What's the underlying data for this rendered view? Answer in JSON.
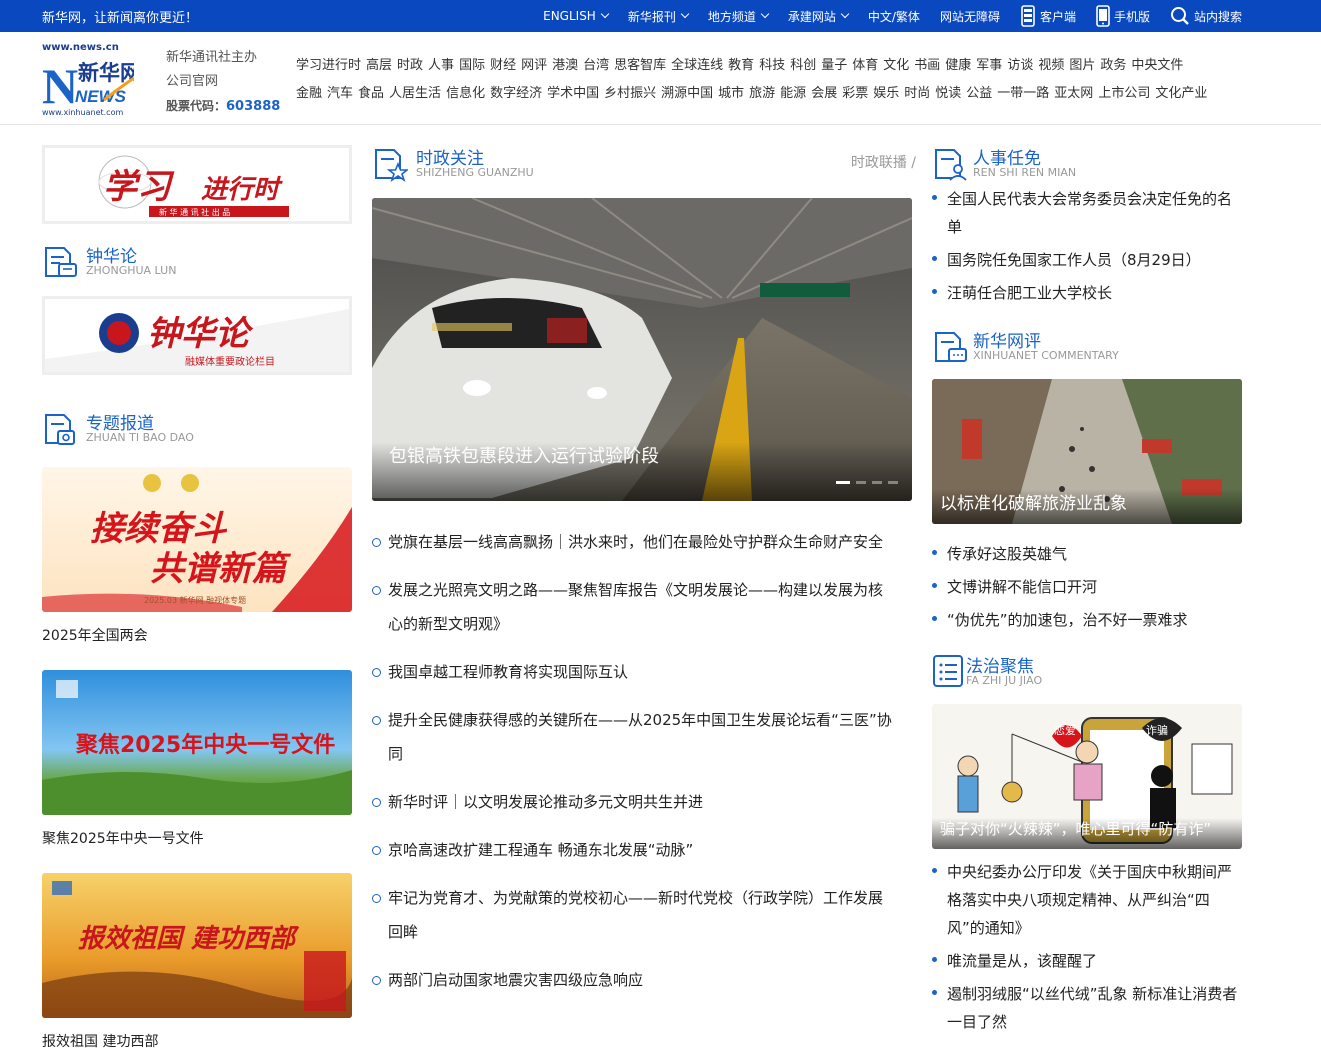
{
  "topbar": {
    "slogan": "新华网，让新闻离你更近！",
    "items": [
      {
        "label": "ENGLISH",
        "dropdown": true
      },
      {
        "label": "新华报刊",
        "dropdown": true
      },
      {
        "label": "地方频道",
        "dropdown": true
      },
      {
        "label": "承建网站",
        "dropdown": true
      },
      {
        "label": "中文/繁体",
        "dropdown": false
      },
      {
        "label": "网站无障碍",
        "dropdown": false
      },
      {
        "label": "客户端",
        "icon": "phone-icon"
      },
      {
        "label": "手机版",
        "icon": "mobile-icon"
      },
      {
        "label": "站内搜索",
        "icon": "search-icon"
      }
    ]
  },
  "header": {
    "logo_url_top": "www.news.cn",
    "logo_text": "新华网",
    "logo_news": "NEWS",
    "logo_url_bottom": "www.xinhuanet.com",
    "org_line1": "新华通讯社主办",
    "org_line2": "公司官网",
    "stock_label": "股票代码：",
    "stock_code": "603888",
    "channels_row1": [
      "学习进行时",
      "高层",
      "时政",
      "人事",
      "国际",
      "财经",
      "网评",
      "港澳",
      "台湾",
      "思客智库",
      "全球连线",
      "教育",
      "科技",
      "科创",
      "量子",
      "体育",
      "文化",
      "书画",
      "健康",
      "军事",
      "访谈",
      "视频",
      "图片",
      "政务",
      "中央文件"
    ],
    "channels_row2": [
      "金融",
      "汽车",
      "食品",
      "人居生活",
      "信息化",
      "数字经济",
      "学术中国",
      "乡村振兴",
      "溯源中国",
      "城市",
      "旅游",
      "能源",
      "会展",
      "彩票",
      "娱乐",
      "时尚",
      "悦读",
      "公益",
      "一带一路",
      "亚太网",
      "上市公司",
      "文化产业"
    ]
  },
  "left": {
    "xuexi_banner": {
      "text1": "学习",
      "text2": "进行时",
      "sub": "新 华 通 讯 社 出 品"
    },
    "zhonghua": {
      "title": "钟华论",
      "sub": "ZHONGHUA LUN",
      "banner_text": "钟华论",
      "banner_sub": "融媒体重要政论栏目"
    },
    "zhuanti": {
      "title": "专题报道",
      "sub": "ZHUAN TI BAO DAO"
    },
    "specials": [
      {
        "caption": "2025年全国两会",
        "img_line1": "接续奋斗",
        "img_line2": "共谱新篇",
        "img_tag": "2025.03  新华网  融视体专题"
      },
      {
        "caption": "聚焦2025年中央一号文件",
        "img_line1": "聚焦2025年中央一号文件"
      },
      {
        "caption": "报效祖国 建功西部",
        "img_line1": "报效祖国 建功西部"
      }
    ]
  },
  "center": {
    "title": "时政关注",
    "sub": "SHIZHENG GUANZHU",
    "more_label": "时政联播",
    "slide_caption": "包银高铁包惠段进入运行试验阶段",
    "slide_dots": 4,
    "news": [
      "党旗在基层一线高高飘扬｜洪水来时，他们在最险处守护群众生命财产安全",
      "发展之光照亮文明之路——聚焦智库报告《文明发展论——构建以发展为核心的新型文明观》",
      "我国卓越工程师教育将实现国际互认",
      "提升全民健康获得感的关键所在——从2025年中国卫生发展论坛看“三医”协同",
      "新华时评｜以文明发展论推动多元文明共生并进",
      "京哈高速改扩建工程通车 畅通东北发展“动脉”",
      "牢记为党育才、为党献策的党校初心——新时代党校（行政学院）工作发展回眸",
      "两部门启动国家地震灾害四级应急响应"
    ]
  },
  "right": {
    "renshi": {
      "title": "人事任免",
      "sub": "REN SHI REN MIAN",
      "items": [
        "全国人民代表大会常务委员会决定任免的名单",
        "国务院任免国家工作人员（8月29日）",
        "汪萌任合肥工业大学校长"
      ]
    },
    "wangping": {
      "title": "新华网评",
      "sub": "XINHUANET COMMENTARY",
      "img_caption": "以标准化破解旅游业乱象",
      "items": [
        "传承好这股英雄气",
        "文博讲解不能信口开河",
        "“伪优先”的加速包，治不好一票难求"
      ]
    },
    "fazhi": {
      "title": "法治聚焦",
      "sub": "FA ZHI JU JIAO",
      "img_caption": "骗子对你“火辣辣”，唯心里可得“防有诈”",
      "img_words": [
        "恋爱",
        "诈骗"
      ],
      "items": [
        "中央纪委办公厅印发《关于国庆中秋期间严格落实中央八项规定精神、从严纠治“四风”的通知》",
        "唯流量是从，该醒醒了",
        "遏制羽绒服“以丝代绒”乱象 新标准让消费者一目了然"
      ]
    }
  },
  "colors": {
    "brand": "#0a48bf",
    "accent": "#1a63c8",
    "red": "#d7141a"
  }
}
